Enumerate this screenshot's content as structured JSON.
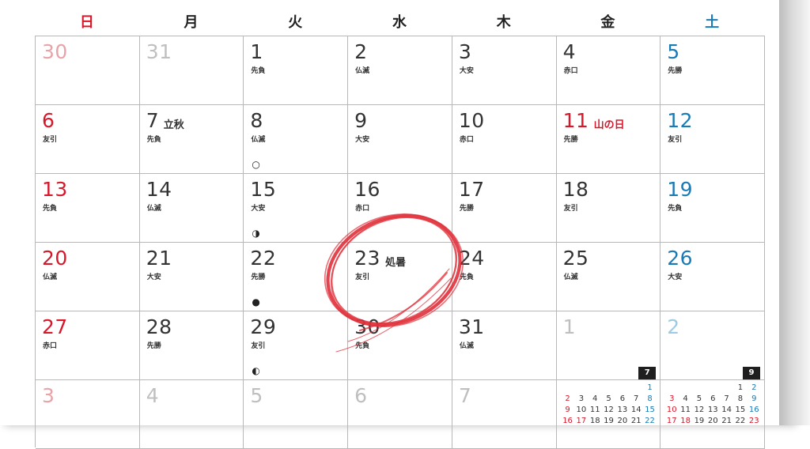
{
  "weekdays": [
    {
      "label": "日",
      "color": "#d7182a"
    },
    {
      "label": "月",
      "color": "#222222"
    },
    {
      "label": "火",
      "color": "#222222"
    },
    {
      "label": "水",
      "color": "#222222"
    },
    {
      "label": "木",
      "color": "#222222"
    },
    {
      "label": "金",
      "color": "#222222"
    },
    {
      "label": "土",
      "color": "#1a7ab6"
    }
  ],
  "weeks": [
    [
      {
        "day": "30",
        "style": "faded-red",
        "rokuyo": ""
      },
      {
        "day": "31",
        "style": "faded",
        "rokuyo": ""
      },
      {
        "day": "1",
        "style": "",
        "rokuyo": "先負"
      },
      {
        "day": "2",
        "style": "",
        "rokuyo": "仏滅"
      },
      {
        "day": "3",
        "style": "",
        "rokuyo": "大安"
      },
      {
        "day": "4",
        "style": "",
        "rokuyo": "赤口"
      },
      {
        "day": "5",
        "style": "blue",
        "rokuyo": "先勝"
      }
    ],
    [
      {
        "day": "6",
        "style": "red",
        "rokuyo": "友引"
      },
      {
        "day": "7",
        "style": "",
        "rokuyo": "先負",
        "holiday": "立秋",
        "holidayStyle": ""
      },
      {
        "day": "8",
        "style": "",
        "rokuyo": "仏滅",
        "moon": "○"
      },
      {
        "day": "9",
        "style": "",
        "rokuyo": "大安"
      },
      {
        "day": "10",
        "style": "",
        "rokuyo": "赤口"
      },
      {
        "day": "11",
        "style": "red",
        "rokuyo": "先勝",
        "holiday": "山の日",
        "holidayStyle": "red"
      },
      {
        "day": "12",
        "style": "blue",
        "rokuyo": "友引"
      }
    ],
    [
      {
        "day": "13",
        "style": "red",
        "rokuyo": "先負"
      },
      {
        "day": "14",
        "style": "",
        "rokuyo": "仏滅"
      },
      {
        "day": "15",
        "style": "",
        "rokuyo": "大安",
        "moon": "◑"
      },
      {
        "day": "16",
        "style": "",
        "rokuyo": "赤口"
      },
      {
        "day": "17",
        "style": "",
        "rokuyo": "先勝"
      },
      {
        "day": "18",
        "style": "",
        "rokuyo": "友引"
      },
      {
        "day": "19",
        "style": "blue",
        "rokuyo": "先負"
      }
    ],
    [
      {
        "day": "20",
        "style": "red",
        "rokuyo": "仏滅"
      },
      {
        "day": "21",
        "style": "",
        "rokuyo": "大安"
      },
      {
        "day": "22",
        "style": "",
        "rokuyo": "先勝",
        "moon": "●"
      },
      {
        "day": "23",
        "style": "",
        "rokuyo": "友引",
        "holiday": "処暑",
        "holidayStyle": ""
      },
      {
        "day": "24",
        "style": "",
        "rokuyo": "先負"
      },
      {
        "day": "25",
        "style": "",
        "rokuyo": "仏滅"
      },
      {
        "day": "26",
        "style": "blue",
        "rokuyo": "大安"
      }
    ],
    [
      {
        "day": "27",
        "style": "red",
        "rokuyo": "赤口"
      },
      {
        "day": "28",
        "style": "",
        "rokuyo": "先勝"
      },
      {
        "day": "29",
        "style": "",
        "rokuyo": "友引",
        "moon": "◐"
      },
      {
        "day": "30",
        "style": "",
        "rokuyo": "先負"
      },
      {
        "day": "31",
        "style": "",
        "rokuyo": "仏滅"
      },
      {
        "day": "1",
        "style": "faded",
        "rokuyo": ""
      },
      {
        "day": "2",
        "style": "faded-blue",
        "rokuyo": ""
      }
    ],
    [
      {
        "day": "3",
        "style": "faded-red",
        "rokuyo": ""
      },
      {
        "day": "4",
        "style": "faded",
        "rokuyo": ""
      },
      {
        "day": "5",
        "style": "faded",
        "rokuyo": ""
      },
      {
        "day": "6",
        "style": "faded",
        "rokuyo": ""
      },
      {
        "day": "7",
        "style": "faded",
        "rokuyo": ""
      },
      {
        "day": "",
        "style": "",
        "rokuyo": ""
      },
      {
        "day": "",
        "style": "",
        "rokuyo": ""
      }
    ]
  ],
  "mini_calendars": [
    {
      "month": "7",
      "rows": [
        [
          "",
          "",
          "",
          "",
          "",
          "",
          "1"
        ],
        [
          "2",
          "3",
          "4",
          "5",
          "6",
          "7",
          "8"
        ],
        [
          "9",
          "10",
          "11",
          "12",
          "13",
          "14",
          "15"
        ],
        [
          "16",
          "17",
          "18",
          "19",
          "20",
          "21",
          "22"
        ]
      ],
      "red": [
        "2",
        "9",
        "16",
        "17"
      ]
    },
    {
      "month": "9",
      "rows": [
        [
          "",
          "",
          "",
          "",
          "",
          "1",
          "2"
        ],
        [
          "3",
          "4",
          "5",
          "6",
          "7",
          "8",
          "9"
        ],
        [
          "10",
          "11",
          "12",
          "13",
          "14",
          "15",
          "16"
        ],
        [
          "17",
          "18",
          "19",
          "20",
          "21",
          "22",
          "23"
        ]
      ],
      "red": [
        "3",
        "10",
        "17",
        "18",
        "23"
      ]
    }
  ],
  "highlight_color": "#e0303a"
}
